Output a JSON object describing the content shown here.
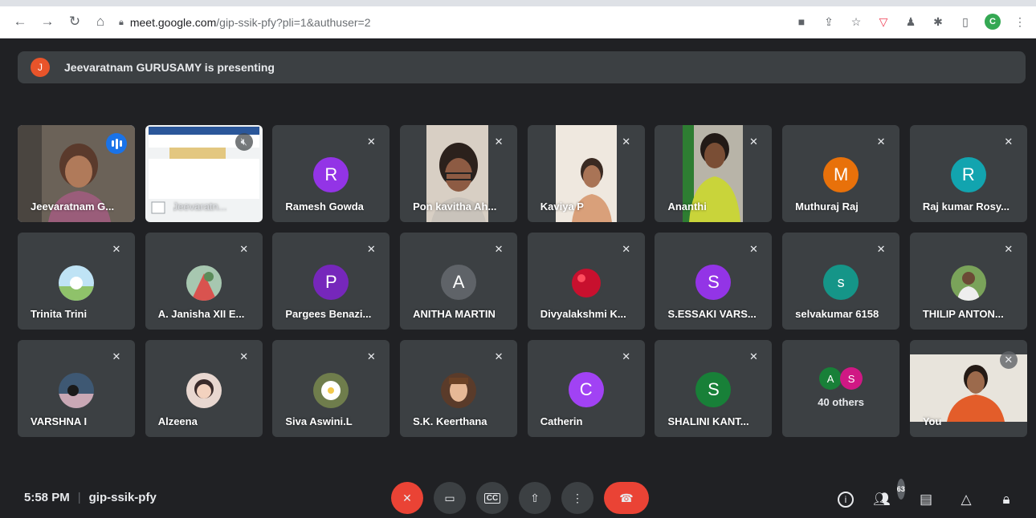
{
  "browser": {
    "url_host": "meet.google.com",
    "url_path": "/gip-ssik-pfy?pli=1&authuser=2",
    "profile_initial": "C"
  },
  "banner": {
    "presenter_initial": "J",
    "text": "Jeevaratnam GURUSAMY is presenting"
  },
  "tiles": [
    {
      "name": "Jeevaratnam G...",
      "type": "video",
      "speaking": true
    },
    {
      "name": "Jeevaratn...",
      "type": "presentation"
    },
    {
      "name": "Ramesh Gowda",
      "type": "initial",
      "initial": "R",
      "color": "#9334e6"
    },
    {
      "name": "Pon kavitha Ah...",
      "type": "video"
    },
    {
      "name": "Kaviya P",
      "type": "video"
    },
    {
      "name": "Ananthi",
      "type": "video"
    },
    {
      "name": "Muthuraj Raj",
      "type": "initial",
      "initial": "M",
      "color": "#e8710a"
    },
    {
      "name": "Raj kumar Rosy...",
      "type": "initial",
      "initial": "R",
      "color": "#12a4af"
    },
    {
      "name": "Trinita Trini",
      "type": "photo"
    },
    {
      "name": "A. Janisha XII E...",
      "type": "photo"
    },
    {
      "name": "Pargees Benazi...",
      "type": "initial",
      "initial": "P",
      "color": "#7627bb"
    },
    {
      "name": "ANITHA MARTIN",
      "type": "initial",
      "initial": "A",
      "color": "#5f6368"
    },
    {
      "name": "Divyalakshmi K...",
      "type": "photo"
    },
    {
      "name": "S.ESSAKI VARS...",
      "type": "initial",
      "initial": "S",
      "color": "#9334e6"
    },
    {
      "name": "selvakumar 6158",
      "type": "initial",
      "initial": "s",
      "color": "#159588"
    },
    {
      "name": "THILIP ANTON...",
      "type": "photo"
    },
    {
      "name": "VARSHNA I",
      "type": "photo"
    },
    {
      "name": "Alzeena",
      "type": "photo"
    },
    {
      "name": "Siva Aswini.L",
      "type": "photo"
    },
    {
      "name": "S.K. Keerthana",
      "type": "photo"
    },
    {
      "name": "Catherin",
      "type": "initial",
      "initial": "C",
      "color": "#a142f4"
    },
    {
      "name": "SHALINI KANT...",
      "type": "initial",
      "initial": "S",
      "color": "#188038"
    },
    {
      "name": "40 others",
      "type": "others",
      "initials": [
        "A",
        "S"
      ],
      "colors": [
        "#188038",
        "#d01884"
      ]
    },
    {
      "name": "You",
      "type": "video"
    }
  ],
  "bottom": {
    "time": "5:58 PM",
    "meeting_code": "gip-ssik-pfy",
    "people_count": "63"
  },
  "colors": {
    "background": "#202124",
    "tile": "#3c4043",
    "hangup": "#ea4335",
    "accent": "#8ab4f8"
  }
}
